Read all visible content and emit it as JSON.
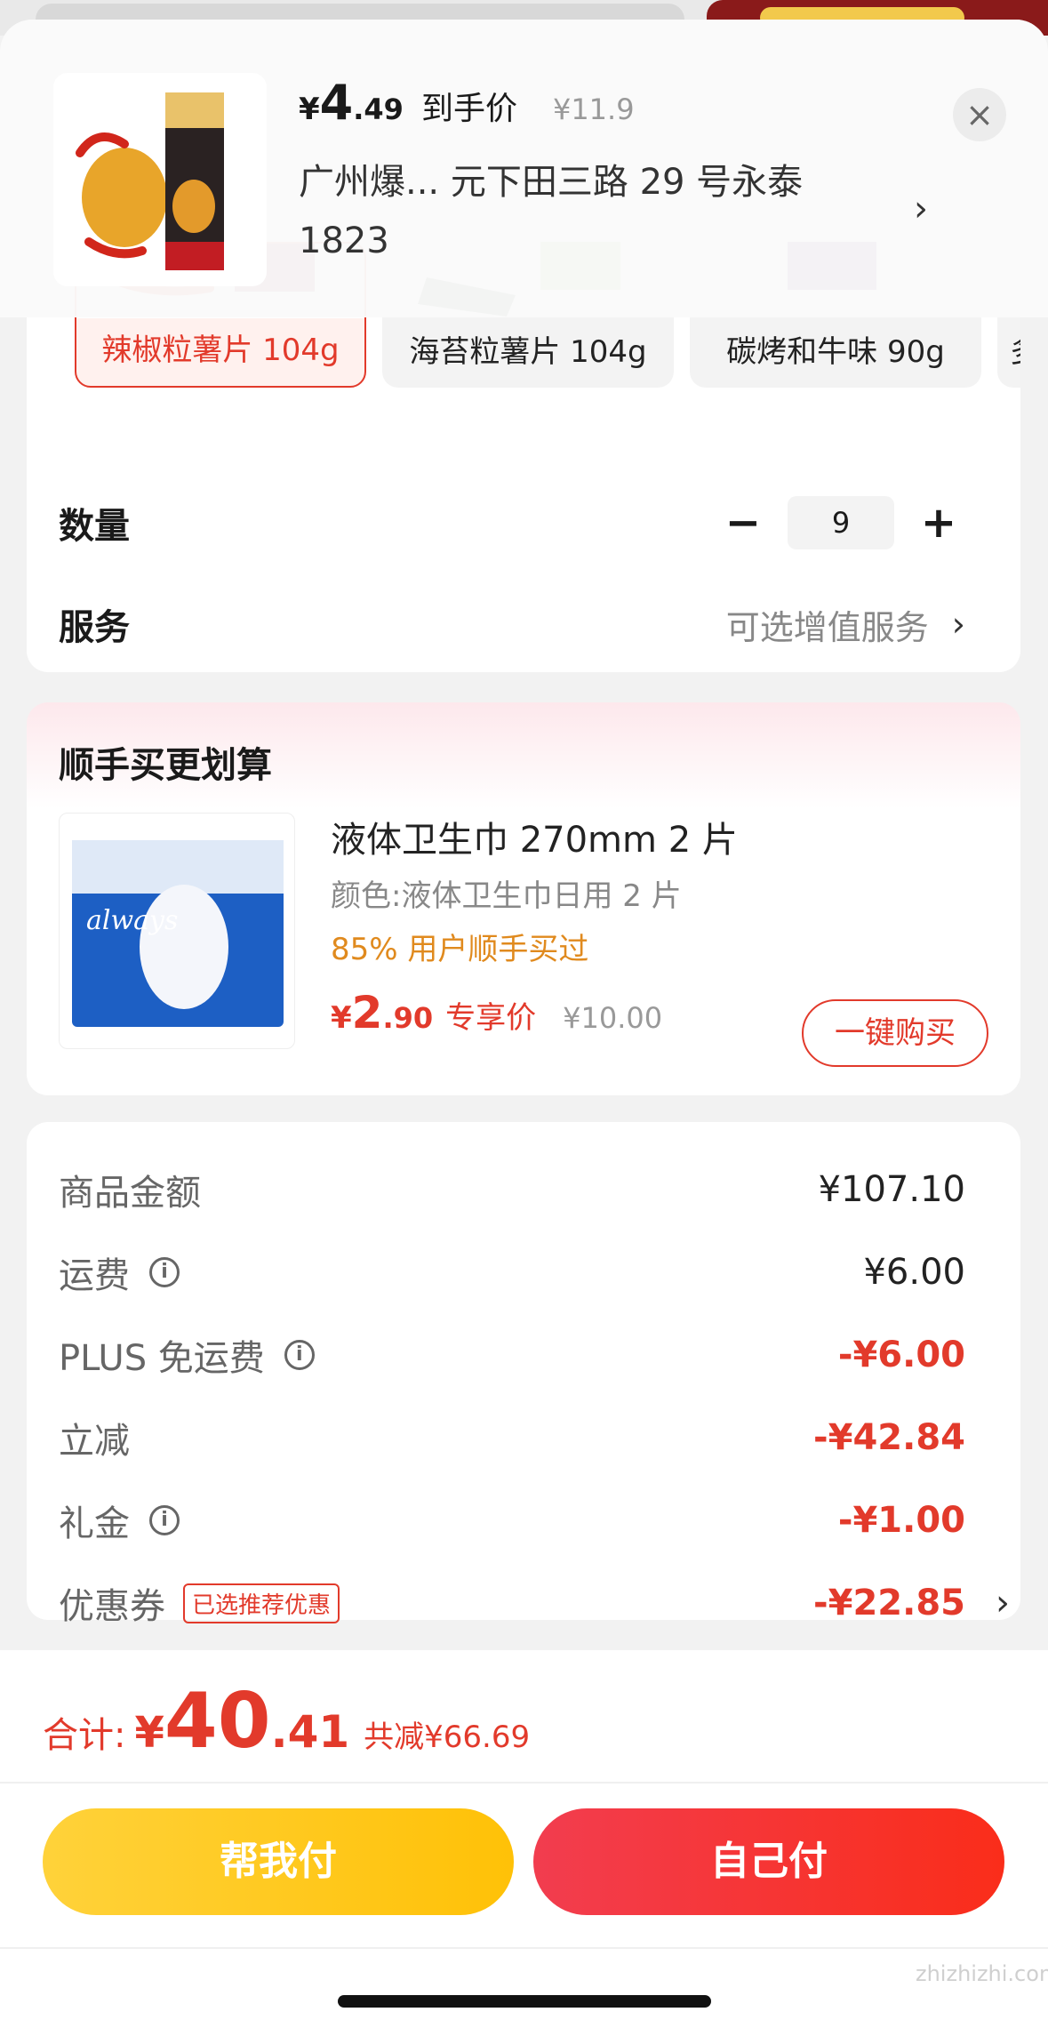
{
  "header": {
    "price_yen": "¥",
    "price_int": "4",
    "price_dec": ".49",
    "price_label": "到手价",
    "orig_price": "¥11.9",
    "address": "广州爆...  元下田三路 29 号永泰 1823",
    "close_icon": "×",
    "arrow_icon": "›"
  },
  "variants": [
    {
      "label": "辣椒粒薯片 104g",
      "selected": true
    },
    {
      "label": "海苔粒薯片 104g",
      "selected": false
    },
    {
      "label": "碳烤和牛味 90g",
      "selected": false
    },
    {
      "label": "多",
      "selected": false
    }
  ],
  "quantity": {
    "label": "数量",
    "minus": "−",
    "value": "9",
    "plus": "+"
  },
  "service": {
    "label": "服务",
    "value": "可选增值服务",
    "chevron": "›"
  },
  "addon": {
    "title": "顺手买更划算",
    "product_name": "液体卫生巾 270mm 2 片",
    "spec": "颜色:液体卫生巾日用 2 片",
    "bought": "85% 用户顺手买过",
    "price_yen": "¥",
    "price_int": "2",
    "price_dec": ".90",
    "price_label": "专享价",
    "orig_price": "¥10.00",
    "buy_button": "一键购买",
    "brand_text": "always"
  },
  "fees": [
    {
      "label": "商品金额",
      "value": "¥107.10",
      "red": false,
      "info": false
    },
    {
      "label": "运费",
      "value": "¥6.00",
      "red": false,
      "info": true
    },
    {
      "label": "PLUS 免运费",
      "value": "-¥6.00",
      "red": true,
      "info": true
    },
    {
      "label": "立减",
      "value": "-¥42.84",
      "red": true,
      "info": false
    },
    {
      "label": "礼金",
      "value": "-¥1.00",
      "red": true,
      "info": true
    },
    {
      "label": "优惠券",
      "value": "-¥22.85",
      "red": true,
      "info": false,
      "badge": "已选推荐优惠",
      "chevron": "›"
    }
  ],
  "footer": {
    "total_label": "合计:",
    "total_yen": "¥",
    "total_int": "40",
    "total_dec": ".41",
    "reduce_text": "共减¥66.69",
    "pay_help": "帮我付",
    "pay_self": "自己付",
    "watermark": "zhizhizhi.com"
  },
  "colors": {
    "accent": "#e23a2b",
    "orange": "#e08a1e",
    "yellow": "#ffc107"
  }
}
